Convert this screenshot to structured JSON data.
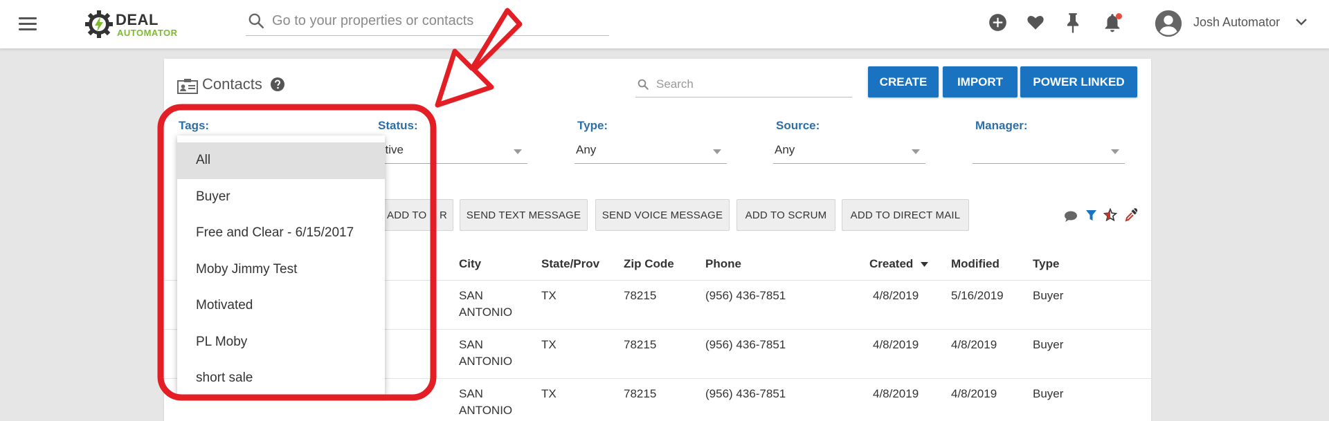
{
  "header": {
    "logo_top": "DEAL",
    "logo_bottom": "AUTOMATOR",
    "search_placeholder": "Go to your properties or contacts",
    "user_name": "Josh Automator"
  },
  "page": {
    "title": "Contacts",
    "search_placeholder": "Search",
    "buttons": {
      "create": "CREATE",
      "import": "IMPORT",
      "power_linked": "POWER LINKED"
    }
  },
  "filters": {
    "tags": {
      "label": "Tags:"
    },
    "status": {
      "label": "Status:",
      "value": "ctive"
    },
    "type": {
      "label": "Type:",
      "value": "Any"
    },
    "source": {
      "label": "Source:",
      "value": "Any"
    },
    "manager": {
      "label": "Manager:",
      "value": ""
    }
  },
  "actions": {
    "add_to": "ADD TO",
    "add_to_r": "R",
    "send_text": "SEND TEXT MESSAGE",
    "send_voice": "SEND VOICE MESSAGE",
    "add_scrum": "ADD TO SCRUM",
    "add_direct_mail": "ADD TO DIRECT MAIL"
  },
  "table": {
    "columns": [
      "City",
      "State/Prov",
      "Zip Code",
      "Phone",
      "Created",
      "Modified",
      "Type"
    ],
    "rows": [
      {
        "city1": "SAN",
        "city2": "ANTONIO",
        "state": "TX",
        "zip": "78215",
        "phone": "(956) 436-7851",
        "created": "4/8/2019",
        "modified": "5/16/2019",
        "type": "Buyer"
      },
      {
        "city1": "SAN",
        "city2": "ANTONIO",
        "state": "TX",
        "zip": "78215",
        "phone": "(956) 436-7851",
        "created": "4/8/2019",
        "modified": "4/8/2019",
        "type": "Buyer"
      },
      {
        "city1": "SAN",
        "city2": "ANTONIO",
        "state": "TX",
        "zip": "78215",
        "phone": "(956) 436-7851",
        "created": "4/8/2019",
        "modified": "4/8/2019",
        "type": "Buyer"
      }
    ]
  },
  "tags_dropdown": {
    "options": [
      "All",
      "Buyer",
      "Free and Clear - 6/15/2017",
      "Moby Jimmy Test",
      "Motivated",
      "PL Moby",
      "short sale"
    ],
    "selected": "All"
  },
  "colors": {
    "primary_button": "#1a73c0",
    "filter_label": "#2d6ea8",
    "annotation": "#e31e24",
    "logo_green": "#7dbb2e"
  },
  "icons": [
    "menu-icon",
    "gear-bolt-logo-icon",
    "search-icon",
    "add-circle-icon",
    "heart-icon",
    "pin-icon",
    "bell-icon",
    "user-avatar-icon",
    "chevron-down-icon",
    "contact-card-icon",
    "help-icon",
    "comment-icon",
    "filter-icon",
    "star-icon",
    "eyedropper-icon"
  ]
}
